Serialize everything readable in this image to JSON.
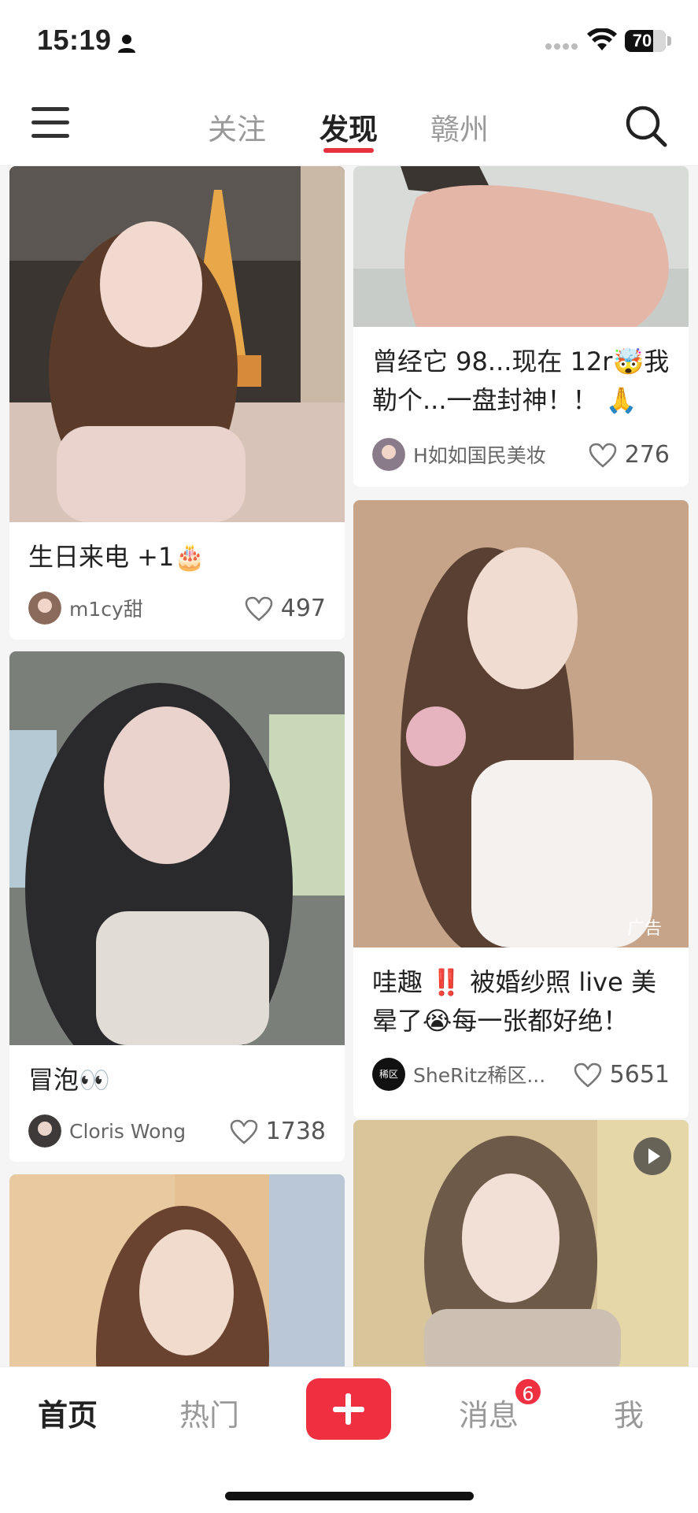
{
  "status_bar": {
    "time": "15:19",
    "battery": "70"
  },
  "top_nav": {
    "tabs": [
      {
        "label": "关注"
      },
      {
        "label": "发现"
      },
      {
        "label": "赣州"
      }
    ],
    "active_tab": "发现"
  },
  "feed": {
    "cards": [
      {
        "title": "生日来电 +1🎂",
        "author": "m1cy甜",
        "likes": "497"
      },
      {
        "title": "冒泡👀",
        "author": "Cloris Wong",
        "likes": "1738"
      },
      {
        "title": "曾经它 98...现在 12r🤯我勒个...一盘封神！！ 🙏",
        "author": "H如如国民美妆",
        "likes": "276"
      },
      {
        "title": "哇趣 ‼️ 被婚纱照 live 美晕了😭每一张都好绝！",
        "author": "SheRitz稀区...",
        "likes": "5651",
        "ad_label": "广告",
        "avatar_text": "稀区"
      }
    ]
  },
  "bottom_bar": {
    "items": [
      {
        "label": "首页"
      },
      {
        "label": "热门"
      },
      {
        "label": "消息"
      },
      {
        "label": "我"
      }
    ],
    "message_badge": "6"
  },
  "colors": {
    "accent": "#ef3040",
    "tab_underline": "#e8313f"
  }
}
